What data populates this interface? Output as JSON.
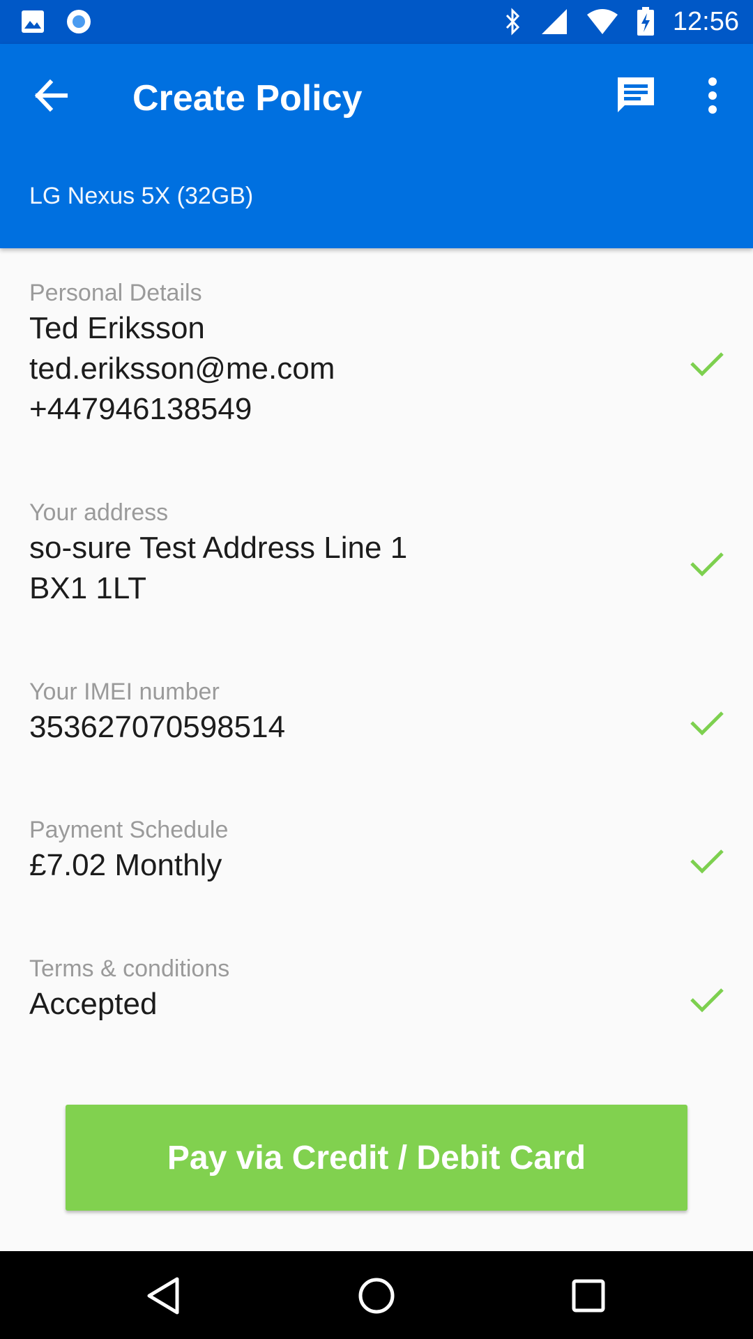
{
  "status_bar": {
    "time": "12:56"
  },
  "app_bar": {
    "title": "Create Policy",
    "subtitle": "LG Nexus 5X (32GB)"
  },
  "sections": [
    {
      "label": "Personal Details",
      "lines": [
        "Ted Eriksson",
        "ted.eriksson@me.com",
        "+447946138549"
      ]
    },
    {
      "label": "Your address",
      "lines": [
        "so-sure Test Address Line 1",
        "BX1 1LT"
      ]
    },
    {
      "label": "Your IMEI number",
      "lines": [
        "353627070598514"
      ]
    },
    {
      "label": "Payment Schedule",
      "lines": [
        "£7.02 Monthly"
      ]
    },
    {
      "label": "Terms & conditions",
      "lines": [
        "Accepted"
      ]
    }
  ],
  "pay_button": {
    "label": "Pay via Credit / Debit Card"
  },
  "colors": {
    "primary": "#0070e0",
    "status_bar": "#0058c7",
    "accent_green": "#81d14f",
    "check_green": "#7dd04f"
  }
}
